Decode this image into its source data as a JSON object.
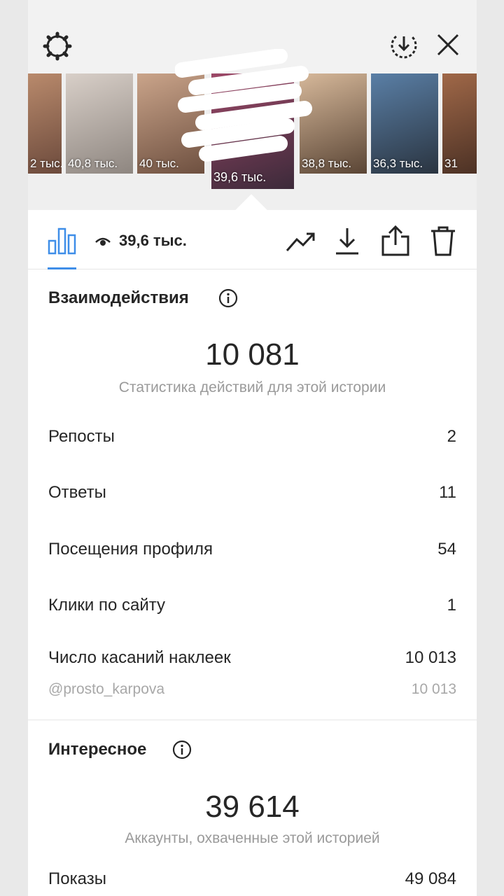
{
  "header": {
    "icons": [
      "gear-icon",
      "download-circle-icon",
      "close-icon"
    ]
  },
  "stories": [
    {
      "views": "2 тыс."
    },
    {
      "views": "40,8 тыс."
    },
    {
      "views": "40 тыс."
    },
    {
      "views": "39,6 тыс.",
      "selected": true
    },
    {
      "views": "38,8 тыс."
    },
    {
      "views": "36,3 тыс."
    },
    {
      "views": "31"
    }
  ],
  "toolbar": {
    "reach": "39,6 тыс.",
    "icons": [
      "bar-chart-icon",
      "eye-icon",
      "trend-icon",
      "download-icon",
      "share-icon",
      "trash-icon"
    ]
  },
  "interactions": {
    "title": "Взаимодействия",
    "total": "10 081",
    "subtitle": "Статистика действий для этой истории",
    "rows": [
      {
        "label": "Репосты",
        "value": "2"
      },
      {
        "label": "Ответы",
        "value": "11"
      },
      {
        "label": "Посещения профиля",
        "value": "54"
      },
      {
        "label": "Клики по сайту",
        "value": "1"
      },
      {
        "label": "Число касаний наклеек",
        "value": "10 013"
      }
    ],
    "sub_row": {
      "label": "@prosto_karpova",
      "value": "10 013"
    }
  },
  "discovery": {
    "title": "Интересное",
    "total": "39 614",
    "subtitle": "Аккаунты, охваченные этой историей",
    "rows": [
      {
        "label": "Показы",
        "value": "49 084"
      }
    ]
  },
  "colors": {
    "accent": "#3f8ee8",
    "text": "#262626",
    "muted": "#9a9a9a"
  }
}
